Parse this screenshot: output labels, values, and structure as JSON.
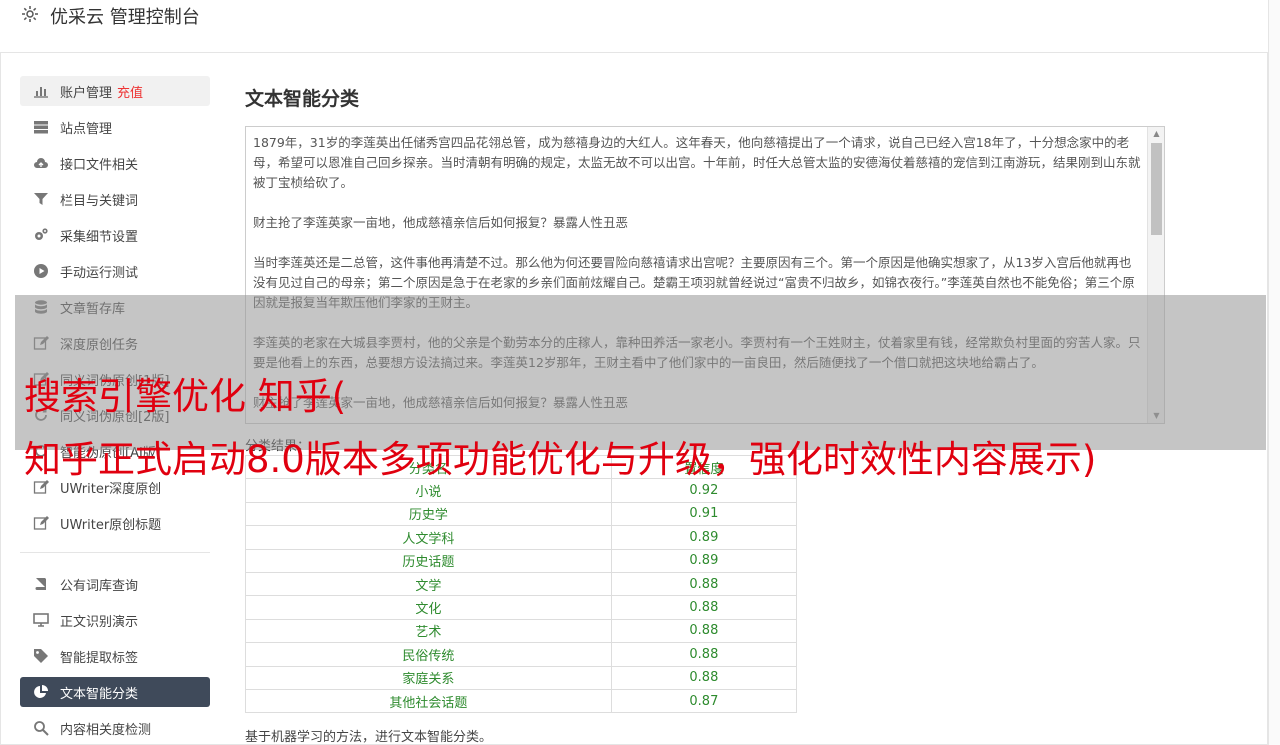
{
  "header": {
    "title": "优采云 管理控制台",
    "icon": "gear-icon"
  },
  "sidebar": {
    "items": [
      {
        "label": "账户管理",
        "badge": "充值",
        "icon": "bar-chart-icon",
        "state": "highlight"
      },
      {
        "label": "站点管理",
        "icon": "server-icon"
      },
      {
        "label": "接口文件相关",
        "icon": "cloud-upload-icon"
      },
      {
        "label": "栏目与关键词",
        "icon": "filter-icon"
      },
      {
        "label": "采集细节设置",
        "icon": "gears-icon"
      },
      {
        "label": "手动运行测试",
        "icon": "play-circle-icon"
      },
      {
        "label": "文章暂存库",
        "icon": "database-icon"
      },
      {
        "label": "深度原创任务",
        "icon": "edit-icon"
      },
      {
        "label": "同义词伪原创[1版]",
        "icon": "edit-icon"
      },
      {
        "label": "同义词伪原创[2版]",
        "icon": "refresh-icon"
      },
      {
        "label": "智能伪原创[AI版]",
        "icon": "refresh-icon"
      },
      {
        "label": "UWriter深度原创",
        "icon": "edit-icon"
      },
      {
        "label": "UWriter原创标题",
        "icon": "edit-icon"
      },
      {
        "label": "公有词库查询",
        "icon": "book-icon"
      },
      {
        "label": "正文识别演示",
        "icon": "monitor-icon"
      },
      {
        "label": "智能提取标签",
        "icon": "tag-icon"
      },
      {
        "label": "文本智能分类",
        "icon": "pie-chart-icon",
        "state": "active"
      },
      {
        "label": "内容相关度检测",
        "icon": "search-icon"
      }
    ]
  },
  "main": {
    "title": "文本智能分类",
    "input_text": "1879年，31岁的李莲英出任储秀宫四品花翎总管，成为慈禧身边的大红人。这年春天，他向慈禧提出了一个请求，说自己已经入宫18年了，十分想念家中的老母，希望可以恩准自己回乡探亲。当时清朝有明确的规定，太监无故不可以出宫。十年前，时任大总管太监的安德海仗着慈禧的宠信到江南游玩，结果刚到山东就被丁宝桢给砍了。\n\n财主抢了李莲英家一亩地，他成慈禧亲信后如何报复？暴露人性丑恶\n\n当时李莲英还是二总管，这件事他再清楚不过。那么他为何还要冒险向慈禧请求出宫呢？主要原因有三个。第一个原因是他确实想家了，从13岁入宫后他就再也没有见过自己的母亲；第二个原因是急于在老家的乡亲们面前炫耀自己。楚霸王项羽就曾经说过“富贵不归故乡，如锦衣夜行。”李莲英自然也不能免俗；第三个原因就是报复当年欺压他们李家的王财主。\n\n李莲英的老家在大城县李贾村，他的父亲是个勤劳本分的庄稼人，靠种田养活一家老小。李贾村有一个王姓财主，仗着家里有钱，经常欺负村里面的穷苦人家。只要是他看上的东西，总要想方设法搞过来。李莲英12岁那年，王财主看中了他们家中的一亩良田，然后随便找了一个借口就把这块地给霸占了。\n\n财主抢了李莲英家一亩地，他成慈禧亲信后如何报复？暴露人性丑恶",
    "result_label": "分类结果：",
    "table": {
      "headers": [
        "分类名",
        "置信度"
      ],
      "rows": [
        [
          "小说",
          "0.92"
        ],
        [
          "历史学",
          "0.91"
        ],
        [
          "人文学科",
          "0.89"
        ],
        [
          "历史话题",
          "0.89"
        ],
        [
          "文学",
          "0.88"
        ],
        [
          "文化",
          "0.88"
        ],
        [
          "艺术",
          "0.88"
        ],
        [
          "民俗传统",
          "0.88"
        ],
        [
          "家庭关系",
          "0.88"
        ],
        [
          "其他社会话题",
          "0.87"
        ]
      ]
    },
    "footnote": "基于机器学习的方法，进行文本智能分类。"
  },
  "overlay": {
    "line1": "搜索引擎优化 知乎(",
    "line2": "知乎正式启动8.0版本多项功能优化与升级，强化时效性内容展示)"
  },
  "colors": {
    "active_nav": "#3f4a5a",
    "result_text": "#2e8b2e",
    "overlay_text": "#e0000f",
    "badge": "#e33333"
  }
}
